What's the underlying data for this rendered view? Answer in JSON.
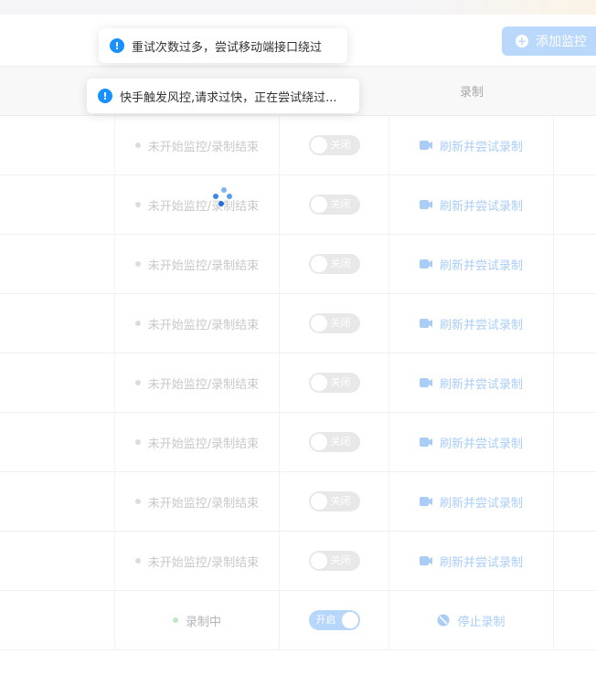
{
  "header": {
    "add_button_label": "添加监控"
  },
  "table": {
    "columns": {
      "record": "录制"
    },
    "rows": [
      {
        "status": "未开始监控/录制结束",
        "switch": "关闭",
        "switch_on": false,
        "action": "刷新并尝试录制"
      },
      {
        "status": "未开始监控/录制结束",
        "switch": "关闭",
        "switch_on": false,
        "action": "刷新并尝试录制"
      },
      {
        "status": "未开始监控/录制结束",
        "switch": "关闭",
        "switch_on": false,
        "action": "刷新并尝试录制"
      },
      {
        "status": "未开始监控/录制结束",
        "switch": "关闭",
        "switch_on": false,
        "action": "刷新并尝试录制"
      },
      {
        "status": "未开始监控/录制结束",
        "switch": "关闭",
        "switch_on": false,
        "action": "刷新并尝试录制"
      },
      {
        "status": "未开始监控/录制结束",
        "switch": "关闭",
        "switch_on": false,
        "action": "刷新并尝试录制"
      },
      {
        "status": "未开始监控/录制结束",
        "switch": "关闭",
        "switch_on": false,
        "action": "刷新并尝试录制"
      },
      {
        "status": "未开始监控/录制结束",
        "switch": "关闭",
        "switch_on": false,
        "action": "刷新并尝试录制"
      },
      {
        "status": "录制中",
        "switch": "开启",
        "switch_on": true,
        "action": "停止录制"
      }
    ]
  },
  "toasts": [
    {
      "text": "重试次数过多，尝试移动端接口绕过"
    },
    {
      "text": "快手触发风控,请求过快，正在尝试绕过..."
    }
  ],
  "colors": {
    "accent": "#1890ff",
    "accent_light": "#b9d8fb",
    "active_dot": "#bfe7c5"
  }
}
